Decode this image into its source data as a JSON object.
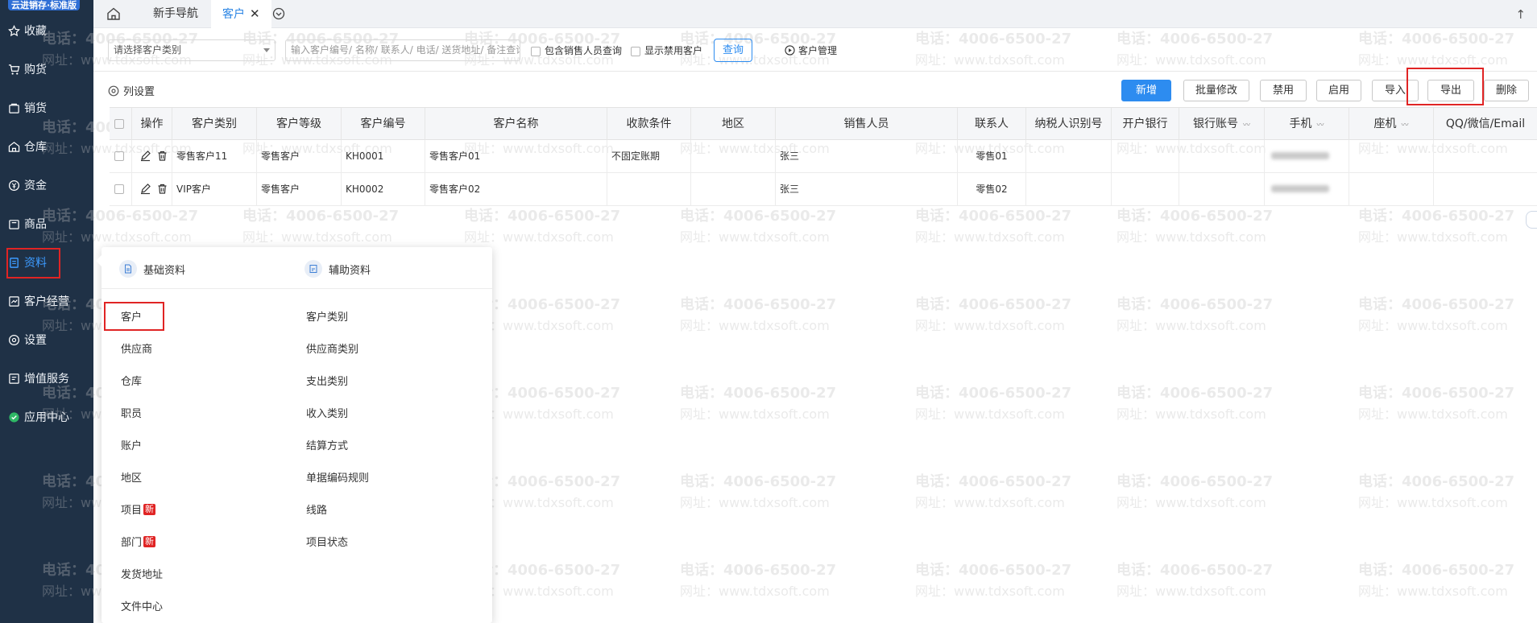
{
  "brand": "云进销存·标准版",
  "sidebar": {
    "items": [
      {
        "label": "收藏",
        "icon": "star-icon"
      },
      {
        "label": "购货",
        "icon": "cart-icon"
      },
      {
        "label": "销货",
        "icon": "sales-icon"
      },
      {
        "label": "仓库",
        "icon": "warehouse-icon"
      },
      {
        "label": "资金",
        "icon": "money-icon"
      },
      {
        "label": "商品",
        "icon": "goods-icon"
      },
      {
        "label": "资料",
        "icon": "data-icon"
      },
      {
        "label": "客户经营",
        "icon": "customer-icon"
      },
      {
        "label": "设置",
        "icon": "settings-icon"
      },
      {
        "label": "增值服务",
        "icon": "service-icon"
      },
      {
        "label": "应用中心",
        "icon": "app-center-icon"
      }
    ]
  },
  "tabs": {
    "items": [
      {
        "label": "新手导航"
      },
      {
        "label": "客户",
        "close": "✕"
      }
    ]
  },
  "filter": {
    "category_placeholder": "请选择客户类别",
    "search_placeholder": "输入客户编号/ 名称/ 联系人/ 电话/ 送货地址/ 备注查询",
    "include_sales": "包含销售人员查询",
    "show_disabled": "显示禁用客户",
    "query": "查询",
    "customer_mgmt": "客户管理"
  },
  "toolbar": {
    "column_settings": "列设置",
    "add": "新增",
    "batch_edit": "批量修改",
    "disable": "禁用",
    "enable": "启用",
    "import": "导入",
    "export": "导出",
    "delete": "删除"
  },
  "table": {
    "columns": [
      "操作",
      "客户类别",
      "客户等级",
      "客户编号",
      "客户名称",
      "收款条件",
      "地区",
      "销售人员",
      "联系人",
      "纳税人识别号",
      "开户银行",
      "银行账号",
      "手机",
      "座机",
      "QQ/微信/Email"
    ],
    "rows": [
      {
        "category": "零售客户11",
        "level": "零售客户",
        "code": "KH0001",
        "name": "零售客户01",
        "terms": "不固定账期",
        "region": "",
        "sales": "张三",
        "contact": "零售01"
      },
      {
        "category": "VIP客户",
        "level": "零售客户",
        "code": "KH0002",
        "name": "零售客户02",
        "terms": "",
        "region": "",
        "sales": "张三",
        "contact": "零售02"
      }
    ]
  },
  "popup": {
    "basic_header": "基础资料",
    "aux_header": "辅助资料",
    "new_badge": "新",
    "basic_items": [
      "客户",
      "供应商",
      "仓库",
      "职员",
      "账户",
      "地区",
      "项目",
      "部门",
      "发货地址",
      "文件中心"
    ],
    "aux_items": [
      "客户类别",
      "供应商类别",
      "支出类别",
      "收入类别",
      "结算方式",
      "单据编码规则",
      "线路",
      "项目状态"
    ]
  },
  "watermark": {
    "phone": "电话：4006-6500-27",
    "site": "网址：www.tdxsoft.com"
  }
}
